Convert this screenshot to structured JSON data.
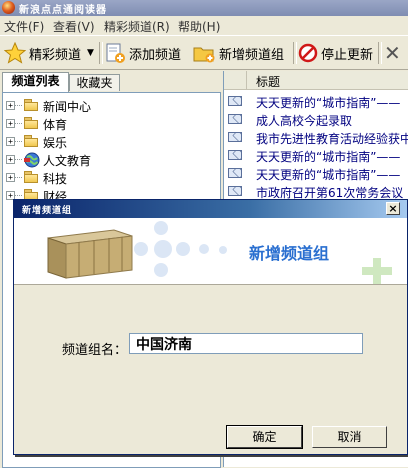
{
  "window": {
    "title": "新浪点点通阅读器"
  },
  "menu": [
    "文件(F)",
    "查看(V)",
    "精彩频道(R)",
    "帮助(H)"
  ],
  "toolbar": {
    "featured_label": "精彩频道",
    "add_channel_label": "添加频道",
    "new_group_label": "新增频道组",
    "stop_update_label": "停止更新"
  },
  "left_panel": {
    "tabs": [
      "频道列表",
      "收藏夹"
    ],
    "tree": [
      "新闻中心",
      "体育",
      "娱乐",
      "人文教育",
      "科技",
      "财经"
    ]
  },
  "right_panel": {
    "column_header": "标题",
    "articles": [
      "天天更新的“城市指南”——",
      "成人高校今起录取",
      "我市先进性教育活动经验获中",
      "天天更新的“城市指南”——",
      "天天更新的“城市指南”——",
      "市政府召开第61次常务会议"
    ]
  },
  "dialog": {
    "title": "新增频道组",
    "heading": "新增频道组",
    "field_label": "频道组名：",
    "field_value": "中国济南",
    "ok_label": "确定",
    "cancel_label": "取消"
  },
  "colors": {
    "heading_blue": "#2a6fd0",
    "titlebar_navy": "#0a246a",
    "link_navy": "#000080"
  }
}
